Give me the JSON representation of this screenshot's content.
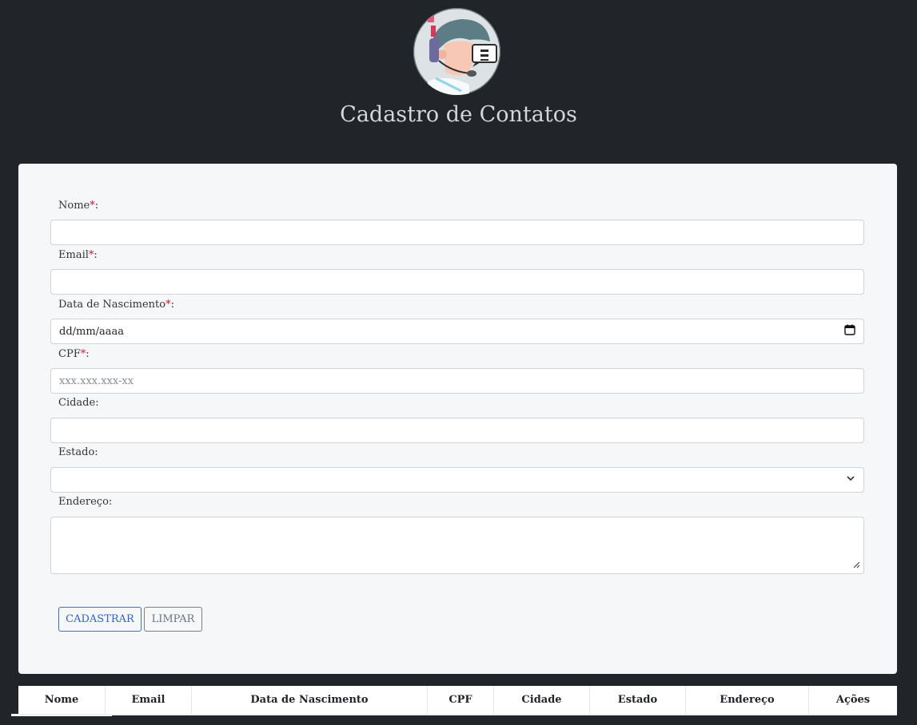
{
  "header": {
    "title": "Cadastro de Contatos",
    "logo_icon": "support-agent-icon"
  },
  "form": {
    "required_mark": "*",
    "nome": {
      "label": "Nome",
      "suffix": ":",
      "value": ""
    },
    "email": {
      "label": "Email",
      "suffix": ":",
      "value": ""
    },
    "nascimento": {
      "label": "Data de Nascimento",
      "suffix": ":",
      "value": "dd/mm/aaaa",
      "icon": "calendar-icon"
    },
    "cpf": {
      "label": "CPF",
      "suffix": ":",
      "placeholder": "xxx.xxx.xxx-xx"
    },
    "cidade": {
      "label": "Cidade:",
      "value": ""
    },
    "estado": {
      "label": "Estado:",
      "value": "",
      "icon": "chevron-down-icon"
    },
    "endereco": {
      "label": "Endereço:",
      "value": ""
    },
    "buttons": {
      "submit": "CADASTRAR",
      "clear": "LIMPAR"
    }
  },
  "table": {
    "headers": [
      "Nome",
      "Email",
      "Data de Nascimento",
      "CPF",
      "Cidade",
      "Estado",
      "Endereço",
      "Ações"
    ]
  },
  "colors": {
    "background": "#212529",
    "card": "#f5f7f9",
    "primary": "#2f63d1",
    "required": "#d11a2a"
  }
}
